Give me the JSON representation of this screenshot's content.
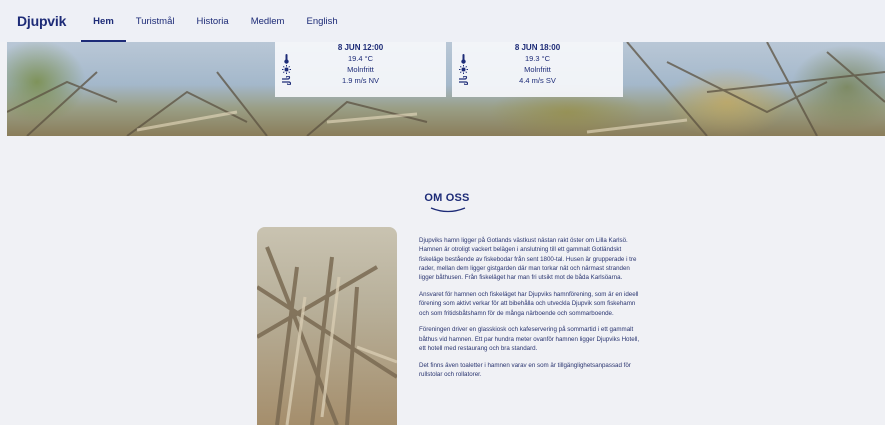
{
  "nav": {
    "brand": "Djupvik",
    "links": [
      {
        "label": "Hem",
        "active": true
      },
      {
        "label": "Turistmål",
        "active": false
      },
      {
        "label": "Historia",
        "active": false
      },
      {
        "label": "Medlem",
        "active": false
      },
      {
        "label": "English",
        "active": false
      }
    ]
  },
  "weather": [
    {
      "title": "8 JUN 12:00",
      "temperature": "19.4 °C",
      "sky": "Molnfritt",
      "wind": "1.9 m/s NV"
    },
    {
      "title": "8 JUN 18:00",
      "temperature": "19.3 °C",
      "sky": "Molnfritt",
      "wind": "4.4 m/s SV"
    }
  ],
  "weather_icons": [
    "thermometer-icon",
    "sun-icon",
    "wind-icon"
  ],
  "about": {
    "title": "OM OSS",
    "paragraphs": [
      "Djupviks hamn ligger på Gotlands västkust nästan rakt öster om Lilla Karlsö. Hamnen är otroligt vackert belägen i anslutning till ett gammalt Gotländskt fiskeläge bestående av fiskebodar från sent 1800-tal. Husen är grupperade i tre rader, mellan dem ligger gistgarden där man torkar nät och närmast stranden ligger båthusen. Från fiskeläget har man fri utsikt mot de båda Karlsöarna.",
      "Ansvaret för hamnen och fiskeläget har Djupviks hamnförening, som är en ideell förening som aktivt verkar för att bibehålla och utveckla Djupvik som fiskehamn och som fritidsbåtshamn för de många närboende och sommarboende.",
      "Föreningen driver en glasskiosk och kafeservering på sommartid i ett gammalt båthus vid hamnen. Ett par hundra meter ovanför hamnen ligger Djupviks Hotell, ett hotell med restaurang och bra standard.",
      "Det finns även toaletter i hamnen varav en som är tillgänglighetsanpassad för rullstolar och rollatorer."
    ]
  },
  "colors": {
    "brand": "#1d2b77",
    "page_bg": "#f0f1f5",
    "nav_bg": "#eef0f6"
  }
}
